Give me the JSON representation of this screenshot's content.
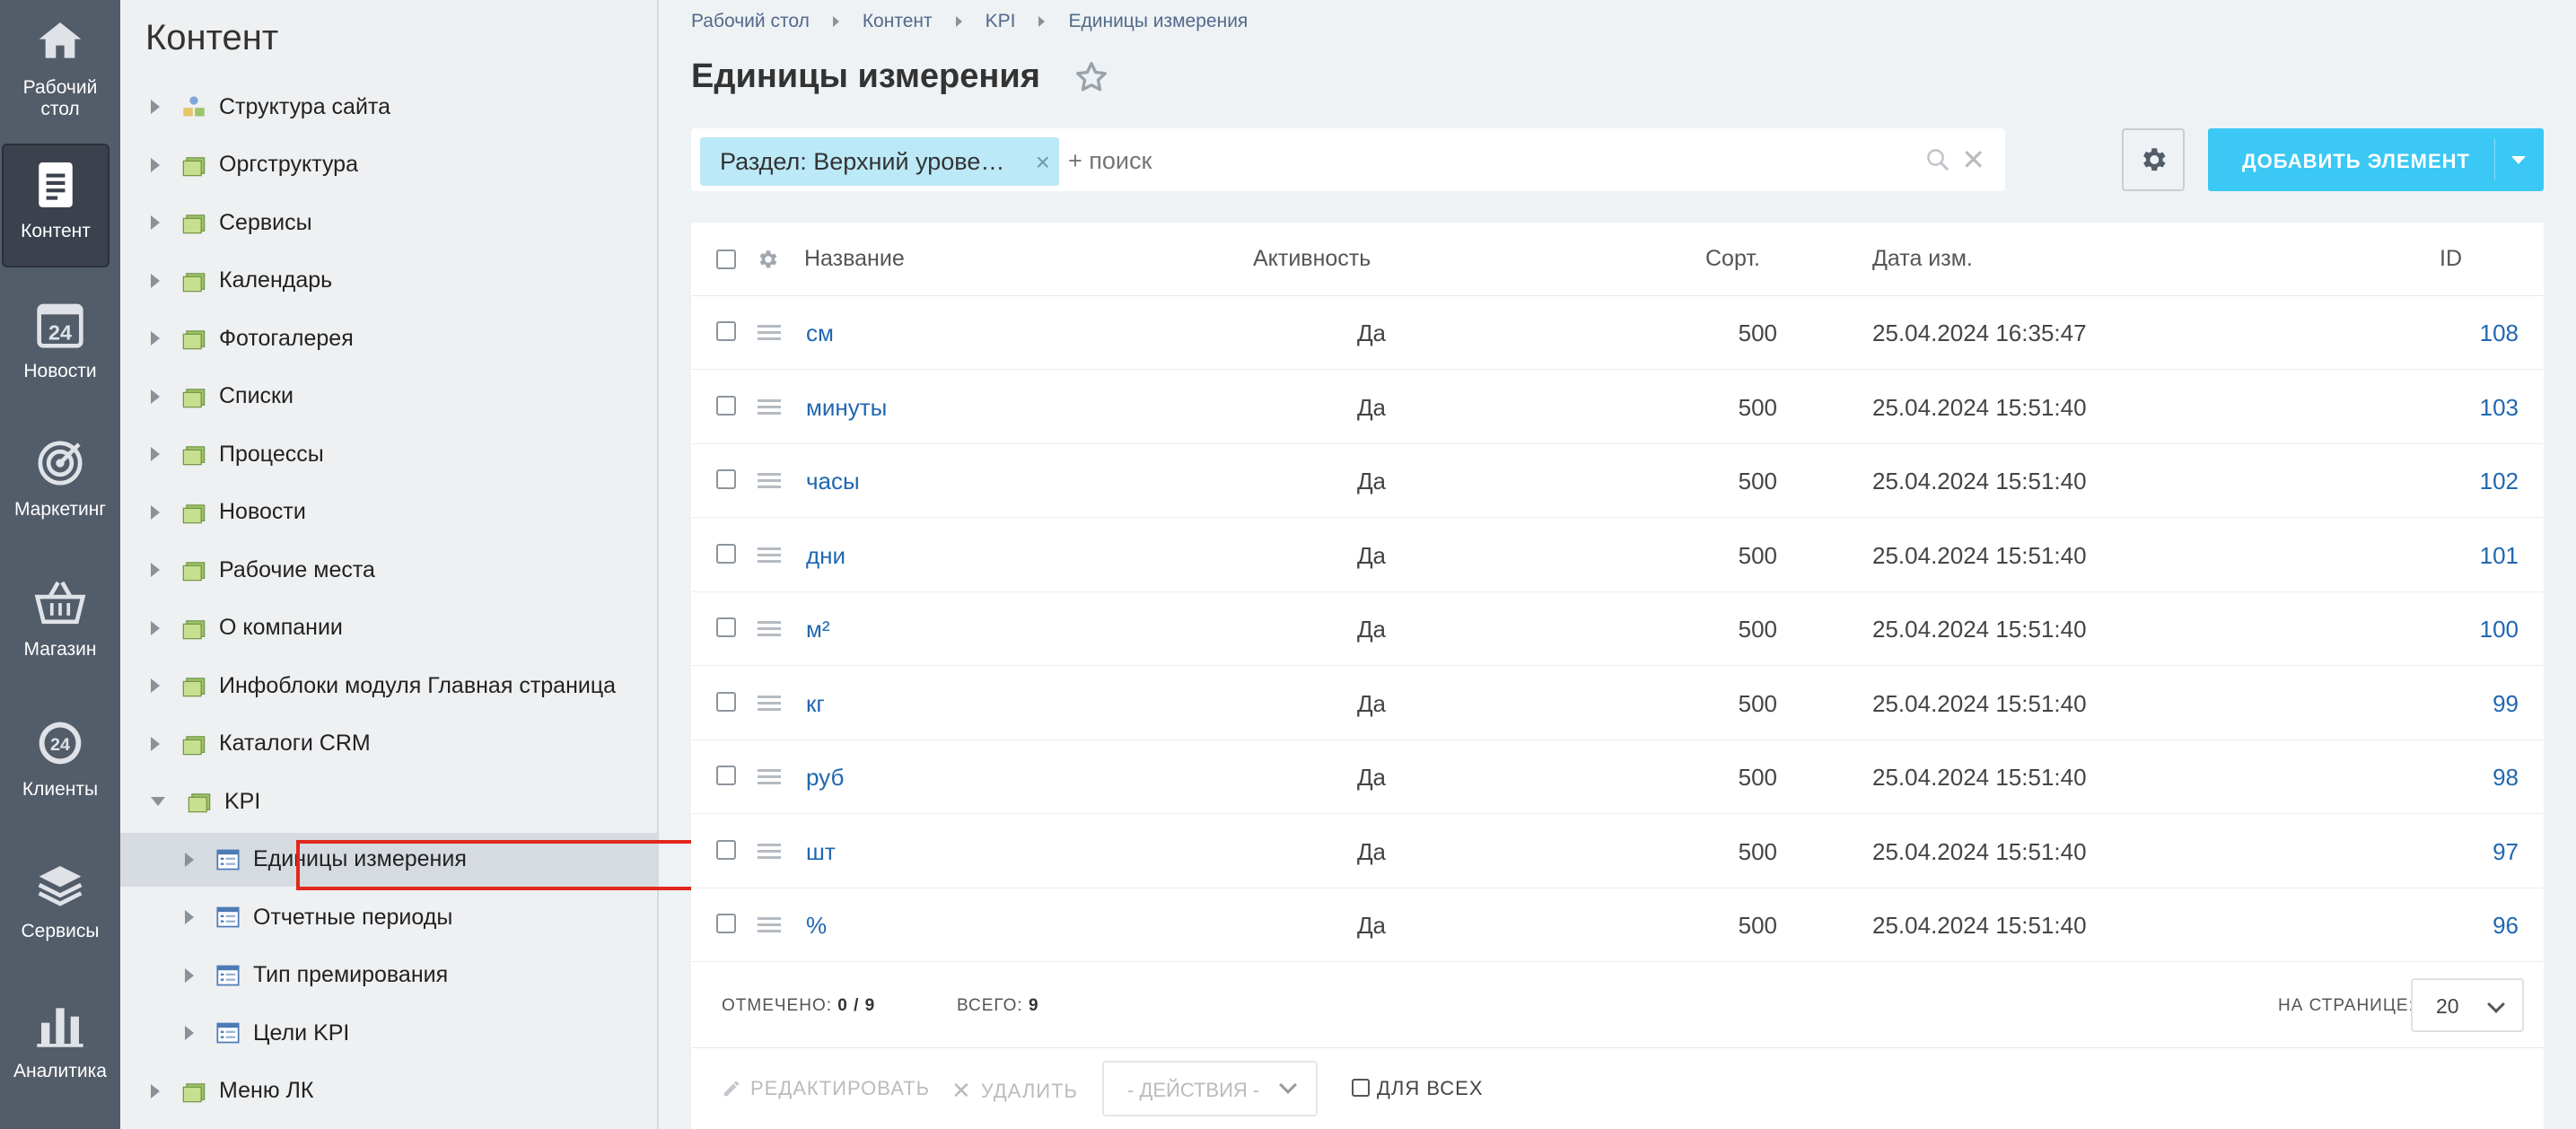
{
  "rail": [
    {
      "id": "desktop",
      "label_line1": "Рабочий",
      "label_line2": "стол",
      "icon": "home-icon"
    },
    {
      "id": "content",
      "label_line1": "Контент",
      "label_line2": "",
      "icon": "document-icon",
      "active": true
    },
    {
      "id": "news",
      "label_line1": "Новости",
      "label_line2": "",
      "icon": "calendar-24-icon"
    },
    {
      "id": "marketing",
      "label_line1": "Маркетинг",
      "label_line2": "",
      "icon": "target-icon"
    },
    {
      "id": "shop",
      "label_line1": "Магазин",
      "label_line2": "",
      "icon": "basket-icon"
    },
    {
      "id": "clients",
      "label_line1": "Клиенты",
      "label_line2": "",
      "icon": "clients-24-icon"
    },
    {
      "id": "services",
      "label_line1": "Сервисы",
      "label_line2": "",
      "icon": "layers-icon"
    },
    {
      "id": "analytics",
      "label_line1": "Аналитика",
      "label_line2": "",
      "icon": "bar-chart-icon"
    }
  ],
  "tree": {
    "title": "Контент",
    "items": [
      {
        "label": "Структура сайта",
        "level": 0,
        "icon": "sitemap-icon"
      },
      {
        "label": "Оргструктура",
        "level": 0,
        "icon": "folder-icon"
      },
      {
        "label": "Сервисы",
        "level": 0,
        "icon": "folder-icon"
      },
      {
        "label": "Календарь",
        "level": 0,
        "icon": "folder-icon"
      },
      {
        "label": "Фотогалерея",
        "level": 0,
        "icon": "folder-icon"
      },
      {
        "label": "Списки",
        "level": 0,
        "icon": "folder-icon"
      },
      {
        "label": "Процессы",
        "level": 0,
        "icon": "folder-icon"
      },
      {
        "label": "Новости",
        "level": 0,
        "icon": "folder-icon"
      },
      {
        "label": "Рабочие места",
        "level": 0,
        "icon": "folder-icon"
      },
      {
        "label": "О компании",
        "level": 0,
        "icon": "folder-icon"
      },
      {
        "label": "Инфоблоки модуля Главная страница",
        "level": 0,
        "icon": "folder-icon"
      },
      {
        "label": "Каталоги CRM",
        "level": 0,
        "icon": "folder-icon"
      },
      {
        "label": "KPI",
        "level": 0,
        "icon": "folder-icon",
        "expanded": true
      },
      {
        "label": "Единицы измерения",
        "level": 1,
        "icon": "list-icon",
        "selected": true
      },
      {
        "label": "Отчетные периоды",
        "level": 1,
        "icon": "list-icon"
      },
      {
        "label": "Тип премирования",
        "level": 1,
        "icon": "list-icon"
      },
      {
        "label": "Цели KPI",
        "level": 1,
        "icon": "list-icon"
      },
      {
        "label": "Меню ЛК",
        "level": 0,
        "icon": "folder-icon"
      }
    ]
  },
  "breadcrumb": [
    "Рабочий стол",
    "Контент",
    "KPI",
    "Единицы измерения"
  ],
  "page_title": "Единицы измерения",
  "filter": {
    "chip": "Раздел: Верхний урове…",
    "chip_close": "×",
    "placeholder": "+ поиск",
    "close": "✕"
  },
  "add_button": "ДОБАВИТЬ ЭЛЕМЕНТ",
  "table": {
    "headers": {
      "name": "Название",
      "active": "Активность",
      "sort": "Сорт.",
      "date": "Дата изм.",
      "id": "ID"
    },
    "rows": [
      {
        "name": "см",
        "active": "Да",
        "sort": "500",
        "date": "25.04.2024 16:35:47",
        "id": "108"
      },
      {
        "name": "минуты",
        "active": "Да",
        "sort": "500",
        "date": "25.04.2024 15:51:40",
        "id": "103"
      },
      {
        "name": "часы",
        "active": "Да",
        "sort": "500",
        "date": "25.04.2024 15:51:40",
        "id": "102"
      },
      {
        "name": "дни",
        "active": "Да",
        "sort": "500",
        "date": "25.04.2024 15:51:40",
        "id": "101"
      },
      {
        "name": "м²",
        "active": "Да",
        "sort": "500",
        "date": "25.04.2024 15:51:40",
        "id": "100"
      },
      {
        "name": "кг",
        "active": "Да",
        "sort": "500",
        "date": "25.04.2024 15:51:40",
        "id": "99"
      },
      {
        "name": "руб",
        "active": "Да",
        "sort": "500",
        "date": "25.04.2024 15:51:40",
        "id": "98"
      },
      {
        "name": "шт",
        "active": "Да",
        "sort": "500",
        "date": "25.04.2024 15:51:40",
        "id": "97"
      },
      {
        "name": "%",
        "active": "Да",
        "sort": "500",
        "date": "25.04.2024 15:51:40",
        "id": "96"
      }
    ]
  },
  "footer": {
    "checked_label": "ОТМЕЧЕНО:",
    "checked_value": "0 / 9",
    "total_label": "ВСЕГО:",
    "total_value": "9",
    "per_page_label": "НА СТРАНИЦЕ:",
    "per_page_value": "20"
  },
  "actions": {
    "edit": "РЕДАКТИРОВАТЬ",
    "delete": "УДАЛИТЬ",
    "select": "- ДЕЙСТВИЯ -",
    "for_all": "ДЛЯ ВСЕХ"
  },
  "colors": {
    "accent": "#3bc8f5",
    "link": "#2067b0",
    "rail": "#535c69",
    "selection_outline": "#e0281c"
  }
}
